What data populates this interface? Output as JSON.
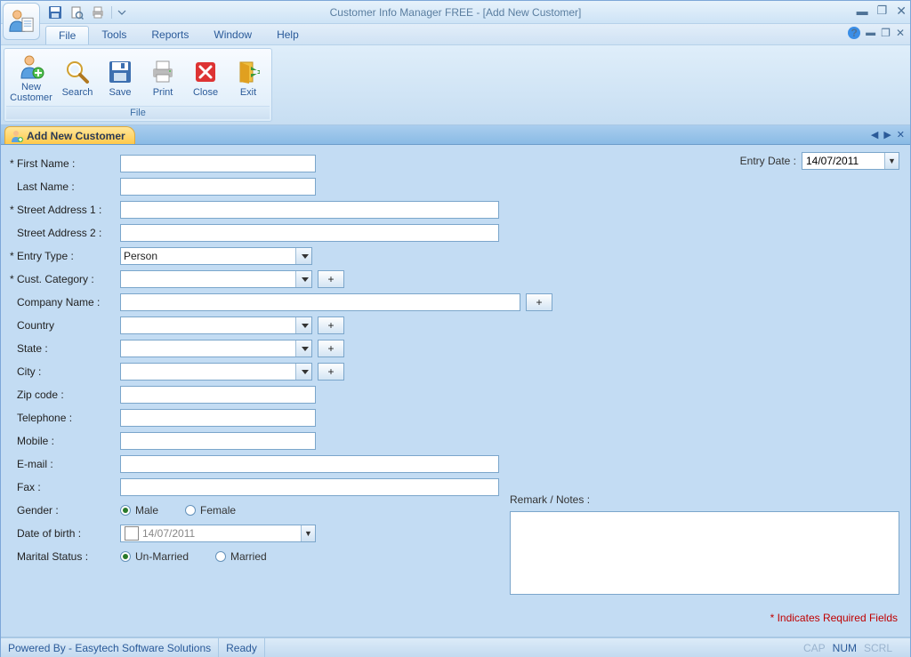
{
  "app": {
    "title": "Customer Info Manager FREE - [Add New Customer]"
  },
  "menubar": {
    "items": [
      "File",
      "Tools",
      "Reports",
      "Window",
      "Help"
    ],
    "activeIndex": 0
  },
  "ribbon": {
    "group_label": "File",
    "buttons": {
      "new_customer": "New Customer",
      "search": "Search",
      "save": "Save",
      "print": "Print",
      "close": "Close",
      "exit": "Exit"
    }
  },
  "tab": {
    "title": "Add New Customer"
  },
  "entry_date": {
    "label": "Entry Date :",
    "value": "14/07/2011"
  },
  "form": {
    "first_name": {
      "label": "First Name :",
      "required": true,
      "value": ""
    },
    "last_name": {
      "label": "Last Name :",
      "required": false,
      "value": ""
    },
    "street1": {
      "label": "Street Address 1 :",
      "required": true,
      "value": ""
    },
    "street2": {
      "label": "Street Address 2 :",
      "required": false,
      "value": ""
    },
    "entry_type": {
      "label": "Entry Type :",
      "required": true,
      "value": "Person"
    },
    "cust_category": {
      "label": "Cust. Category :",
      "required": true,
      "value": ""
    },
    "company_name": {
      "label": "Company Name :",
      "required": false,
      "value": ""
    },
    "country": {
      "label": "Country",
      "required": false,
      "value": ""
    },
    "state": {
      "label": "State :",
      "required": false,
      "value": ""
    },
    "city": {
      "label": "City :",
      "required": false,
      "value": ""
    },
    "zip": {
      "label": "Zip code :",
      "required": false,
      "value": ""
    },
    "telephone": {
      "label": "Telephone :",
      "required": false,
      "value": ""
    },
    "mobile": {
      "label": "Mobile :",
      "required": false,
      "value": ""
    },
    "email": {
      "label": "E-mail :",
      "required": false,
      "value": ""
    },
    "fax": {
      "label": "Fax :",
      "required": false,
      "value": ""
    },
    "gender": {
      "label": "Gender :",
      "options": [
        "Male",
        "Female"
      ],
      "selected": "Male"
    },
    "dob": {
      "label": "Date of birth :",
      "value": "14/07/2011",
      "enabled": false
    },
    "marital": {
      "label": "Marital Status :",
      "options": [
        "Un-Married",
        "Married"
      ],
      "selected": "Un-Married"
    },
    "remark": {
      "label": "Remark / Notes :",
      "value": ""
    }
  },
  "plus_button_label": "+",
  "required_note": "* Indicates Required Fields",
  "statusbar": {
    "powered": "Powered By - Easytech Software Solutions",
    "ready": "Ready",
    "caps": "CAP",
    "num": "NUM",
    "scrl": "SCRL"
  }
}
